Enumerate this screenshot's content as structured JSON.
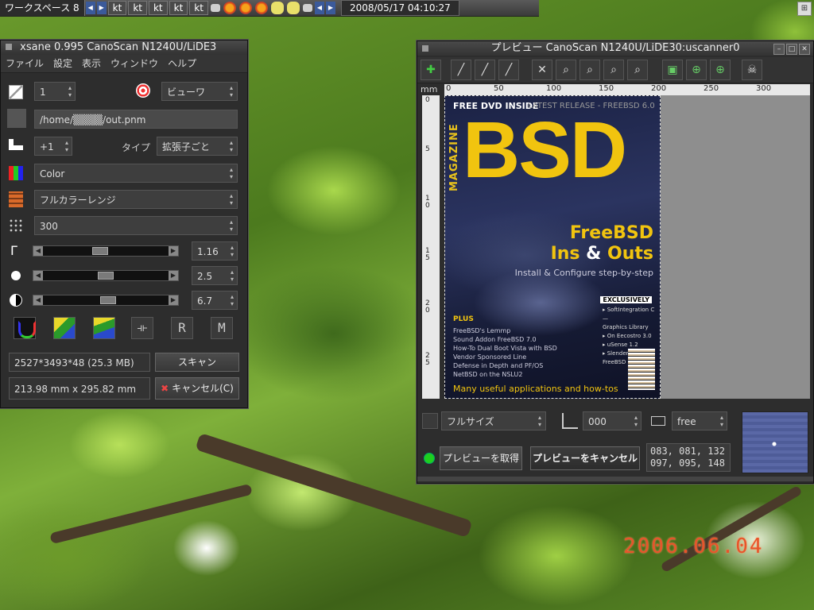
{
  "taskbar": {
    "workspace": "ワークスペース 8",
    "tasks": [
      "kt",
      "kt",
      "kt",
      "kt",
      "kt"
    ],
    "datetime": "2008/05/17 04:10:27"
  },
  "wallpaper": {
    "date_stamp": "2006.06.04"
  },
  "xsane": {
    "title": "xsane 0.995 CanoScan N1240U/LiDE3",
    "menu": [
      "ファイル",
      "設定",
      "表示",
      "ウィンドウ",
      "ヘルプ"
    ],
    "copies": "1",
    "viewer_mode": "ビューワ",
    "filename": "/home/▒▒▒▒/out.pnm",
    "step": "+1",
    "type_label": "タイプ",
    "type_value": "拡張子ごと",
    "color_mode": "Color",
    "color_range": "フルカラーレンジ",
    "resolution": "300",
    "gamma": "1.16",
    "brightness": "2.5",
    "contrast": "6.7",
    "image_size": "2527*3493*48 (25.3 MB)",
    "scan_button": "スキャン",
    "dimensions": "213.98 mm x 295.82 mm",
    "cancel_button": "キャンセル(C)",
    "sliders": {
      "gamma": 0.45,
      "brightness": 0.5,
      "contrast": 0.52
    }
  },
  "preview": {
    "title": "プレビュー CanoScan N1240U/LiDE30:uscanner0",
    "unit": "mm",
    "ruler_ticks": [
      "0",
      "50",
      "100",
      "150",
      "200",
      "250",
      "300"
    ],
    "ruler_v_ticks": [
      "0",
      "5",
      "1\n0",
      "1\n5",
      "2\n0",
      "2\n5"
    ],
    "size_preset": "フルサイズ",
    "rotation": "000",
    "aspect": "free",
    "acquire_button": "プレビューを取得",
    "cancel_button": "プレビューをキャンセル",
    "rgb_line1": "083, 081, 132",
    "rgb_line2": "097, 095, 148",
    "cover": {
      "header_left": "FREE DVD INSIDE",
      "header_right": "LATEST RELEASE - FREEBSD 6.0",
      "side": "MAGAZINE",
      "logo": "BSD",
      "headline1": "FreeBSD",
      "headline2_a": "Ins ",
      "headline2_amp": "&",
      "headline2_b": " Outs",
      "subhead": "Install & Configure step-by-step",
      "exclusive": "EXCLUSIVELY",
      "plus": "PLUS",
      "plus_items": [
        "FreeBSD's Lemmp",
        "Sound Addon FreeBSD 7.0",
        "How-To Dual Boot Vista with BSD",
        "Vendor Sponsored Line",
        "Defense in Depth and PF/OS",
        "NetBSD on the NSLU2"
      ],
      "right_items": [
        "▸ SoftIntegration C—",
        "  Graphics Library",
        "▸ On Eecostro 3.0",
        "▸ uSense 1.2",
        "▸ Slender for FreeBSD"
      ],
      "footer": "Many useful applications and how-tos"
    }
  }
}
